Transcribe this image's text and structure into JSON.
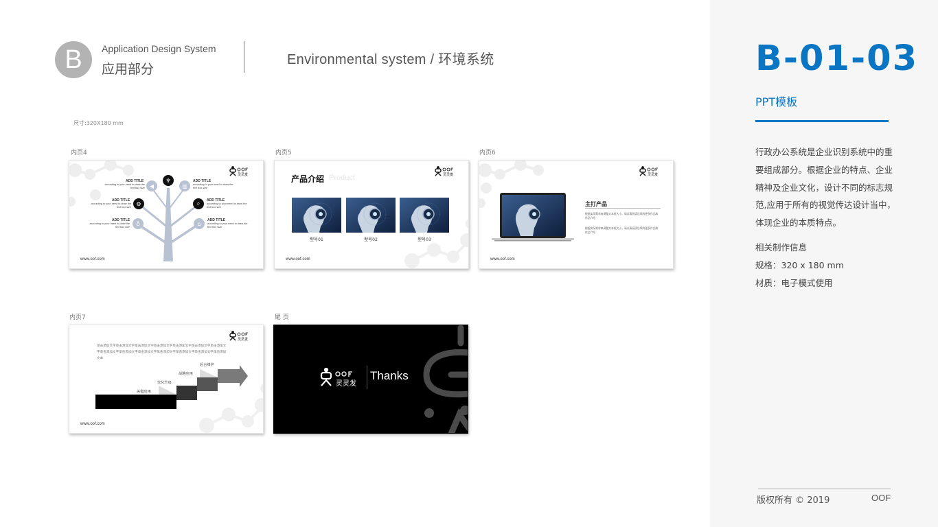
{
  "header": {
    "badge_letter": "B",
    "section_en": "Application Design System",
    "section_cn": "应用部分",
    "subsection": "Environmental system / 环境系统",
    "size_note": "尺寸:320X180 mm"
  },
  "slides": {
    "inner4": {
      "label": "内页4",
      "url": "www.oof.com",
      "branches": [
        {
          "title": "ADD TITLE",
          "desc": "according to your need to draw the text box size",
          "icon": "megaphone-icon"
        },
        {
          "title": "ADD TITLE",
          "desc": "according to your need to draw the text box size",
          "icon": "bar-chart-icon"
        },
        {
          "title": "ADD TITLE",
          "desc": "according to your need to draw the text box size",
          "icon": "gear-search-icon"
        },
        {
          "title": "ADD TITLE",
          "desc": "according to your need to draw the text box size",
          "icon": "magnifier-icon"
        },
        {
          "title": "ADD TITLE",
          "desc": "according to your need to draw the text box size",
          "icon": "lightbulb-icon"
        },
        {
          "title": "ADD TITLE",
          "desc": "according to your need to draw the text box size",
          "icon": "house-icon"
        }
      ],
      "top_icon": "trophy-icon"
    },
    "inner5": {
      "label": "内页5",
      "title_cn": "产品介绍",
      "title_en": "Product",
      "url": "www.oof.com",
      "models": [
        "型号01",
        "型号02",
        "型号03"
      ]
    },
    "inner6": {
      "label": "内页6",
      "feature_title": "主打产品",
      "paragraphs": [
        "根据实际需求来调整文本框大小，请认真阅读后续的更多作品和作品介绍",
        "根据实际需求来调整文本框大小，请认真阅读后续的更多作品和作品介绍"
      ],
      "url": "www.oof.com"
    },
    "inner7": {
      "label": "内页7",
      "body_text": "单击添加文字单击添加文字单击添加文字单击添加文字单击添加文字单击添加文字单击添加文字单击添加文字单击添加文字单击添加文字单击添加文字单击添加文字单击添加文字单击添加文本",
      "steps": [
        "关键应用",
        "优化升级",
        "战略应用",
        "后台维护"
      ],
      "url": "www.oof.com"
    },
    "end": {
      "label": "尾 页",
      "thanks": "Thanks",
      "brand_en": "OOF",
      "brand_cn": "灵灵发"
    }
  },
  "panel": {
    "code": "B-01-03",
    "subtitle": "PPT模板",
    "description": "行政办公系统是企业识别系统中的重要组成部分。根据企业的特点、企业精神及企业文化，设计不同的标志规范,应用于所有的视觉传达设计当中，体现企业的本质特点。",
    "info_heading": "相关制作信息",
    "spec": "规格：320 x 180  mm",
    "material": "材质：电子模式使用",
    "copyright": "版权所有 ©   2019",
    "brand": "OOF",
    "accent_color": "#0a75c2"
  }
}
